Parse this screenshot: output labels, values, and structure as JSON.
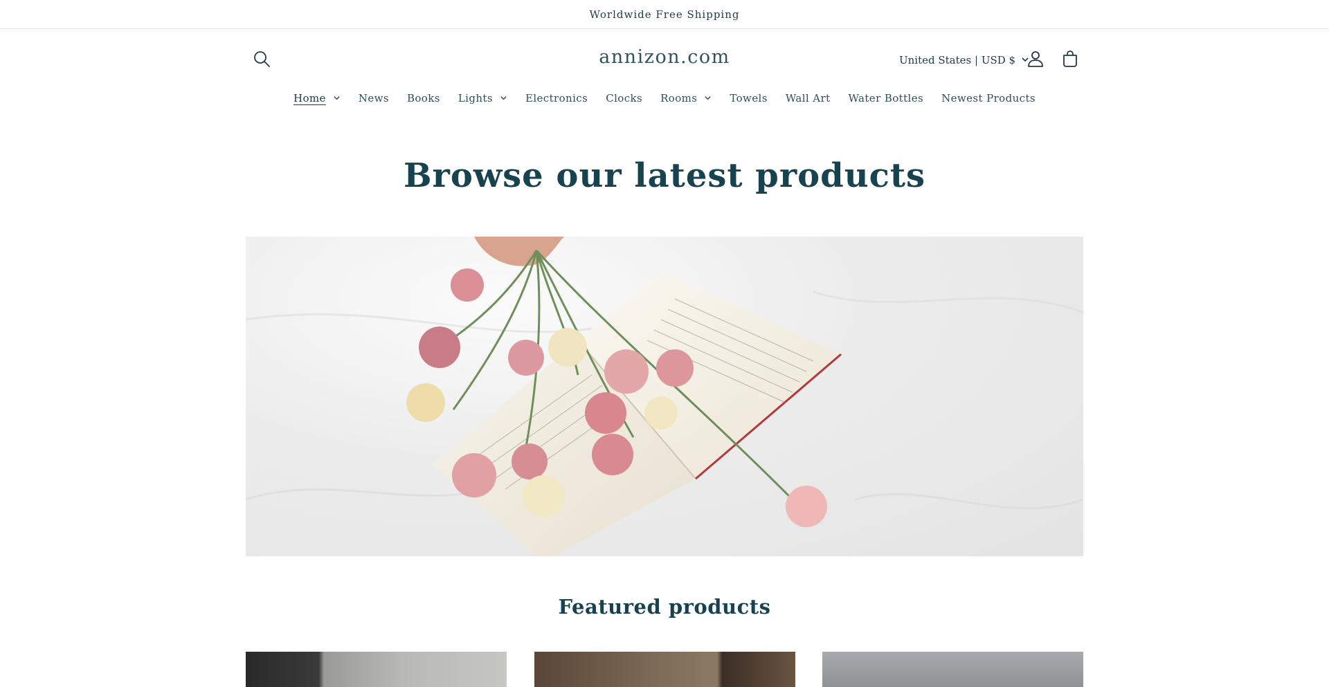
{
  "announcement": {
    "text": "Worldwide Free Shipping"
  },
  "header": {
    "logo": "annizon.com",
    "country_selector": "United States | USD $",
    "icons": {
      "search": "search-icon",
      "account": "account-icon",
      "cart": "cart-icon"
    }
  },
  "nav": {
    "items": [
      {
        "label": "Home",
        "dropdown": true,
        "active": true
      },
      {
        "label": "News",
        "dropdown": false
      },
      {
        "label": "Books",
        "dropdown": false
      },
      {
        "label": "Lights",
        "dropdown": true
      },
      {
        "label": "Electronics",
        "dropdown": false
      },
      {
        "label": "Clocks",
        "dropdown": false
      },
      {
        "label": "Rooms",
        "dropdown": true
      },
      {
        "label": "Towels",
        "dropdown": false
      },
      {
        "label": "Wall Art",
        "dropdown": false
      },
      {
        "label": "Water Bottles",
        "dropdown": false
      },
      {
        "label": "Newest Products",
        "dropdown": false
      }
    ]
  },
  "hero": {
    "title": "Browse our latest products"
  },
  "featured": {
    "title": "Featured products"
  },
  "colors": {
    "heading": "#17424f",
    "text": "#1f3b45",
    "border": "#e6e6e6"
  }
}
